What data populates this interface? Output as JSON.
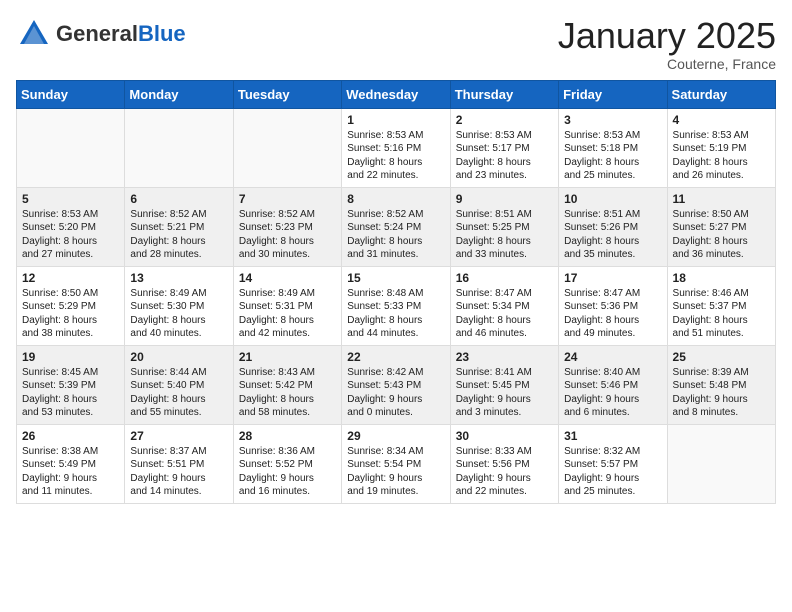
{
  "header": {
    "logo_general": "General",
    "logo_blue": "Blue",
    "month_title": "January 2025",
    "location": "Couterne, France"
  },
  "weekdays": [
    "Sunday",
    "Monday",
    "Tuesday",
    "Wednesday",
    "Thursday",
    "Friday",
    "Saturday"
  ],
  "weeks": [
    [
      {
        "day": "",
        "info": ""
      },
      {
        "day": "",
        "info": ""
      },
      {
        "day": "",
        "info": ""
      },
      {
        "day": "1",
        "info": "Sunrise: 8:53 AM\nSunset: 5:16 PM\nDaylight: 8 hours\nand 22 minutes."
      },
      {
        "day": "2",
        "info": "Sunrise: 8:53 AM\nSunset: 5:17 PM\nDaylight: 8 hours\nand 23 minutes."
      },
      {
        "day": "3",
        "info": "Sunrise: 8:53 AM\nSunset: 5:18 PM\nDaylight: 8 hours\nand 25 minutes."
      },
      {
        "day": "4",
        "info": "Sunrise: 8:53 AM\nSunset: 5:19 PM\nDaylight: 8 hours\nand 26 minutes."
      }
    ],
    [
      {
        "day": "5",
        "info": "Sunrise: 8:53 AM\nSunset: 5:20 PM\nDaylight: 8 hours\nand 27 minutes."
      },
      {
        "day": "6",
        "info": "Sunrise: 8:52 AM\nSunset: 5:21 PM\nDaylight: 8 hours\nand 28 minutes."
      },
      {
        "day": "7",
        "info": "Sunrise: 8:52 AM\nSunset: 5:23 PM\nDaylight: 8 hours\nand 30 minutes."
      },
      {
        "day": "8",
        "info": "Sunrise: 8:52 AM\nSunset: 5:24 PM\nDaylight: 8 hours\nand 31 minutes."
      },
      {
        "day": "9",
        "info": "Sunrise: 8:51 AM\nSunset: 5:25 PM\nDaylight: 8 hours\nand 33 minutes."
      },
      {
        "day": "10",
        "info": "Sunrise: 8:51 AM\nSunset: 5:26 PM\nDaylight: 8 hours\nand 35 minutes."
      },
      {
        "day": "11",
        "info": "Sunrise: 8:50 AM\nSunset: 5:27 PM\nDaylight: 8 hours\nand 36 minutes."
      }
    ],
    [
      {
        "day": "12",
        "info": "Sunrise: 8:50 AM\nSunset: 5:29 PM\nDaylight: 8 hours\nand 38 minutes."
      },
      {
        "day": "13",
        "info": "Sunrise: 8:49 AM\nSunset: 5:30 PM\nDaylight: 8 hours\nand 40 minutes."
      },
      {
        "day": "14",
        "info": "Sunrise: 8:49 AM\nSunset: 5:31 PM\nDaylight: 8 hours\nand 42 minutes."
      },
      {
        "day": "15",
        "info": "Sunrise: 8:48 AM\nSunset: 5:33 PM\nDaylight: 8 hours\nand 44 minutes."
      },
      {
        "day": "16",
        "info": "Sunrise: 8:47 AM\nSunset: 5:34 PM\nDaylight: 8 hours\nand 46 minutes."
      },
      {
        "day": "17",
        "info": "Sunrise: 8:47 AM\nSunset: 5:36 PM\nDaylight: 8 hours\nand 49 minutes."
      },
      {
        "day": "18",
        "info": "Sunrise: 8:46 AM\nSunset: 5:37 PM\nDaylight: 8 hours\nand 51 minutes."
      }
    ],
    [
      {
        "day": "19",
        "info": "Sunrise: 8:45 AM\nSunset: 5:39 PM\nDaylight: 8 hours\nand 53 minutes."
      },
      {
        "day": "20",
        "info": "Sunrise: 8:44 AM\nSunset: 5:40 PM\nDaylight: 8 hours\nand 55 minutes."
      },
      {
        "day": "21",
        "info": "Sunrise: 8:43 AM\nSunset: 5:42 PM\nDaylight: 8 hours\nand 58 minutes."
      },
      {
        "day": "22",
        "info": "Sunrise: 8:42 AM\nSunset: 5:43 PM\nDaylight: 9 hours\nand 0 minutes."
      },
      {
        "day": "23",
        "info": "Sunrise: 8:41 AM\nSunset: 5:45 PM\nDaylight: 9 hours\nand 3 minutes."
      },
      {
        "day": "24",
        "info": "Sunrise: 8:40 AM\nSunset: 5:46 PM\nDaylight: 9 hours\nand 6 minutes."
      },
      {
        "day": "25",
        "info": "Sunrise: 8:39 AM\nSunset: 5:48 PM\nDaylight: 9 hours\nand 8 minutes."
      }
    ],
    [
      {
        "day": "26",
        "info": "Sunrise: 8:38 AM\nSunset: 5:49 PM\nDaylight: 9 hours\nand 11 minutes."
      },
      {
        "day": "27",
        "info": "Sunrise: 8:37 AM\nSunset: 5:51 PM\nDaylight: 9 hours\nand 14 minutes."
      },
      {
        "day": "28",
        "info": "Sunrise: 8:36 AM\nSunset: 5:52 PM\nDaylight: 9 hours\nand 16 minutes."
      },
      {
        "day": "29",
        "info": "Sunrise: 8:34 AM\nSunset: 5:54 PM\nDaylight: 9 hours\nand 19 minutes."
      },
      {
        "day": "30",
        "info": "Sunrise: 8:33 AM\nSunset: 5:56 PM\nDaylight: 9 hours\nand 22 minutes."
      },
      {
        "day": "31",
        "info": "Sunrise: 8:32 AM\nSunset: 5:57 PM\nDaylight: 9 hours\nand 25 minutes."
      },
      {
        "day": "",
        "info": ""
      }
    ]
  ]
}
